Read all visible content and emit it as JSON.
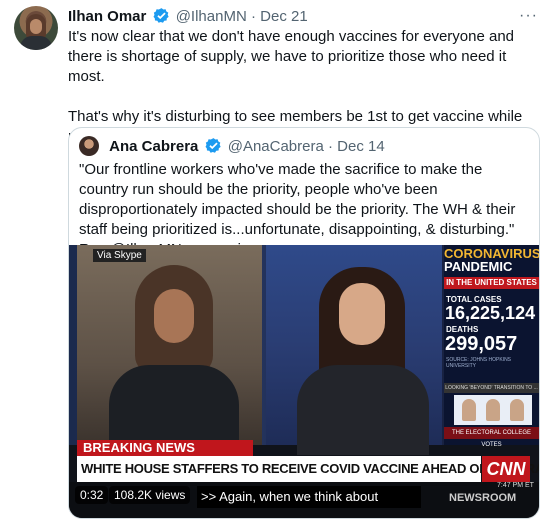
{
  "tweet": {
    "author_name": "Ilhan Omar",
    "handle": "@IlhanMN",
    "separator": "·",
    "date": "Dec 21",
    "more_icon": "more-horizontal-icon",
    "paragraph_1": "It's now clear that we don't have enough vaccines for everyone and there is shortage of supply, we have to prioritize those who need it most.",
    "paragraph_2": "That's why it's disturbing to see members be 1st to get vaccine while most frontline workers, elderly and infirm in our districts, wait."
  },
  "quoted_tweet": {
    "author_name": "Ana Cabrera",
    "handle": "@AnaCabrera",
    "separator": "·",
    "date": "Dec 14",
    "text": "\"Our frontline workers who've made the sacrifice to make the country run should be the priority, people who've been disproportionately impacted should be the priority. The WH & their staff being prioritized is...unfortunate, disappointing, & disturbing.\" Rep @IlhanMN on vaccines"
  },
  "video": {
    "skype_label": "Via Skype",
    "coronavirus": "CORONAVIRUS",
    "pandemic": "PANDEMIC",
    "in_us": "IN THE UNITED STATES",
    "total_cases_label": "TOTAL CASES",
    "total_cases": "16,225,124",
    "deaths_label": "DEATHS",
    "deaths": "299,057",
    "source": "SOURCE: JOHNS HOPKINS UNIVERSITY",
    "lower_tag": "LOOKING 'BEYOND' TRANSITION TO ...",
    "electoral": "THE ELECTORAL COLLEGE VOTES",
    "breaking": "BREAKING NEWS",
    "headline": "WHITE HOUSE STAFFERS TO RECEIVE COVID VACCINE AHEAD OF GENERAL PUBLIC",
    "network": "CNN",
    "clock": "7:47 PM ET",
    "show": "NEWSROOM",
    "elapsed": "0:32",
    "views": "108.2K views",
    "caption": ">> Again, when we think about"
  },
  "colors": {
    "verified": "#1d9bf0",
    "cnn_red": "#c0161c"
  }
}
